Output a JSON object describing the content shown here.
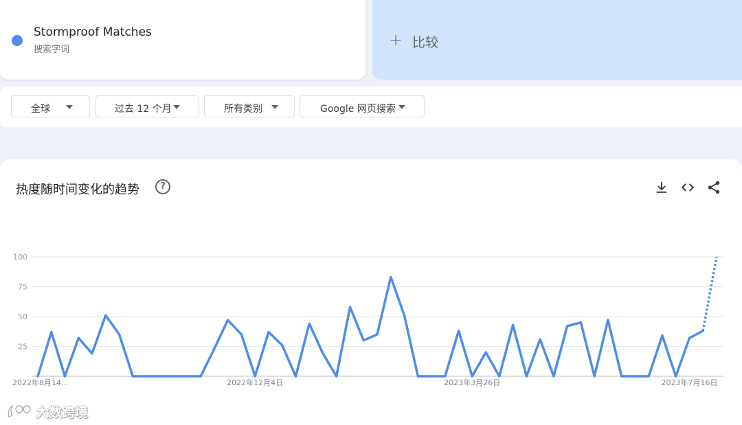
{
  "term": {
    "name": "Stormproof Matches",
    "subtitle": "搜索字词",
    "color": "#4e8de8"
  },
  "compare": {
    "plus": "+",
    "label": "比较"
  },
  "filters": [
    {
      "label": "全球"
    },
    {
      "label": "过去 12 个月"
    },
    {
      "label": "所有类别"
    },
    {
      "label": "Google 网页搜索"
    }
  ],
  "chart_header": {
    "title": "热度随时间变化的趋势",
    "help": "?",
    "icons": [
      "download-icon",
      "embed-code-icon",
      "share-icon"
    ]
  },
  "watermark": {
    "text": "大数跨境"
  },
  "chart_data": {
    "type": "line",
    "title": "热度随时间变化的趋势",
    "xlabel": "",
    "ylabel": "",
    "ylim": [
      0,
      100
    ],
    "yticks": [
      25,
      50,
      75,
      100
    ],
    "grid": true,
    "x_tick_labels": [
      {
        "index": 0,
        "label": "2022年8月14…"
      },
      {
        "index": 16,
        "label": "2022年12月4日"
      },
      {
        "index": 32,
        "label": "2023年3月26日"
      },
      {
        "index": 48,
        "label": "2023年7月16日"
      }
    ],
    "series": [
      {
        "name": "Stormproof Matches",
        "color": "#4e8de8",
        "partial_from_index": 49,
        "values": [
          0,
          37,
          0,
          32,
          19,
          51,
          35,
          0,
          0,
          0,
          0,
          0,
          0,
          23,
          47,
          35,
          0,
          37,
          26,
          0,
          44,
          19,
          0,
          58,
          30,
          35,
          83,
          51,
          0,
          0,
          0,
          38,
          0,
          20,
          0,
          43,
          0,
          31,
          0,
          42,
          45,
          0,
          47,
          0,
          0,
          0,
          34,
          0,
          32,
          38,
          100
        ]
      }
    ]
  }
}
